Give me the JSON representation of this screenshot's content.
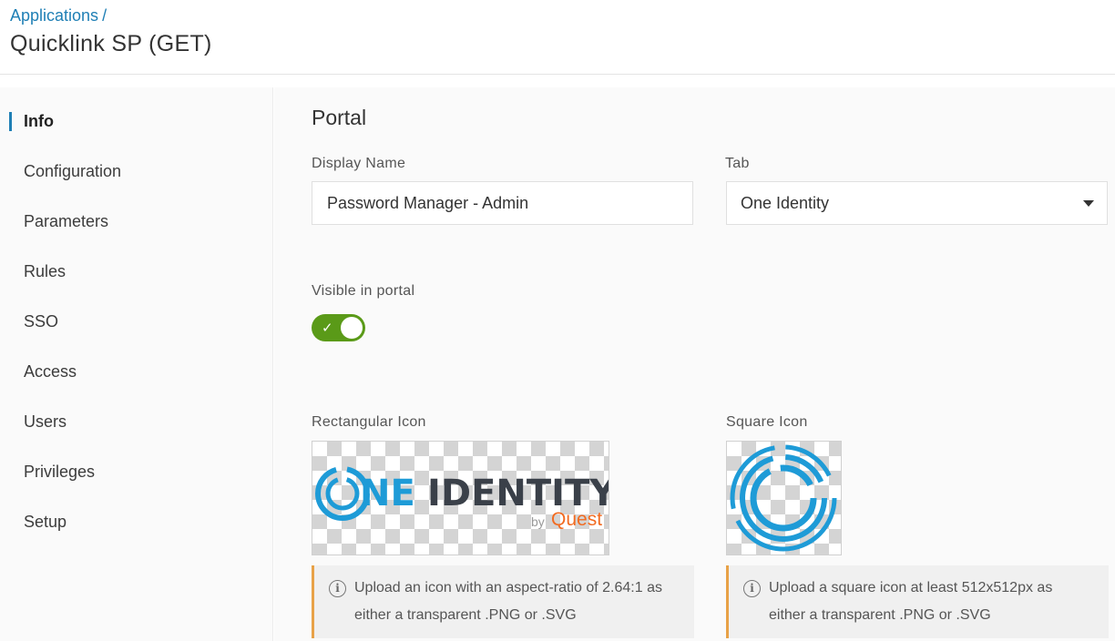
{
  "header": {
    "breadcrumb": {
      "parent": "Applications",
      "separator": "/"
    },
    "title": "Quicklink SP (GET)"
  },
  "sidebar": {
    "active": "Info",
    "items": [
      {
        "label": "Info"
      },
      {
        "label": "Configuration"
      },
      {
        "label": "Parameters"
      },
      {
        "label": "Rules"
      },
      {
        "label": "SSO"
      },
      {
        "label": "Access"
      },
      {
        "label": "Users"
      },
      {
        "label": "Privileges"
      },
      {
        "label": "Setup"
      }
    ]
  },
  "portal": {
    "section_title": "Portal",
    "display_name": {
      "label": "Display Name",
      "value": "Password Manager - Admin"
    },
    "tab": {
      "label": "Tab",
      "value": "One Identity"
    },
    "visible": {
      "label": "Visible in portal",
      "on": true
    },
    "rect_icon": {
      "label": "Rectangular Icon",
      "logo_word1": "NE",
      "logo_word2": "IDENTITY",
      "logo_by": "by",
      "logo_brand": "Quest",
      "hint_line1": "Upload an icon with an aspect-ratio of 2.64:1 as",
      "hint_line2": "either a transparent .PNG or .SVG"
    },
    "square_icon": {
      "label": "Square Icon",
      "hint_line1": "Upload a square icon at least 512x512px as",
      "hint_line2": "either a transparent .PNG or .SVG"
    },
    "info_glyph": "i"
  },
  "colors": {
    "accent": "#1f7fb5",
    "toggle_on": "#5a9a18",
    "hint_border": "#e8a248",
    "logo_blue": "#1e9bd7",
    "logo_dark": "#3a4049",
    "quest_orange": "#f26b21"
  }
}
